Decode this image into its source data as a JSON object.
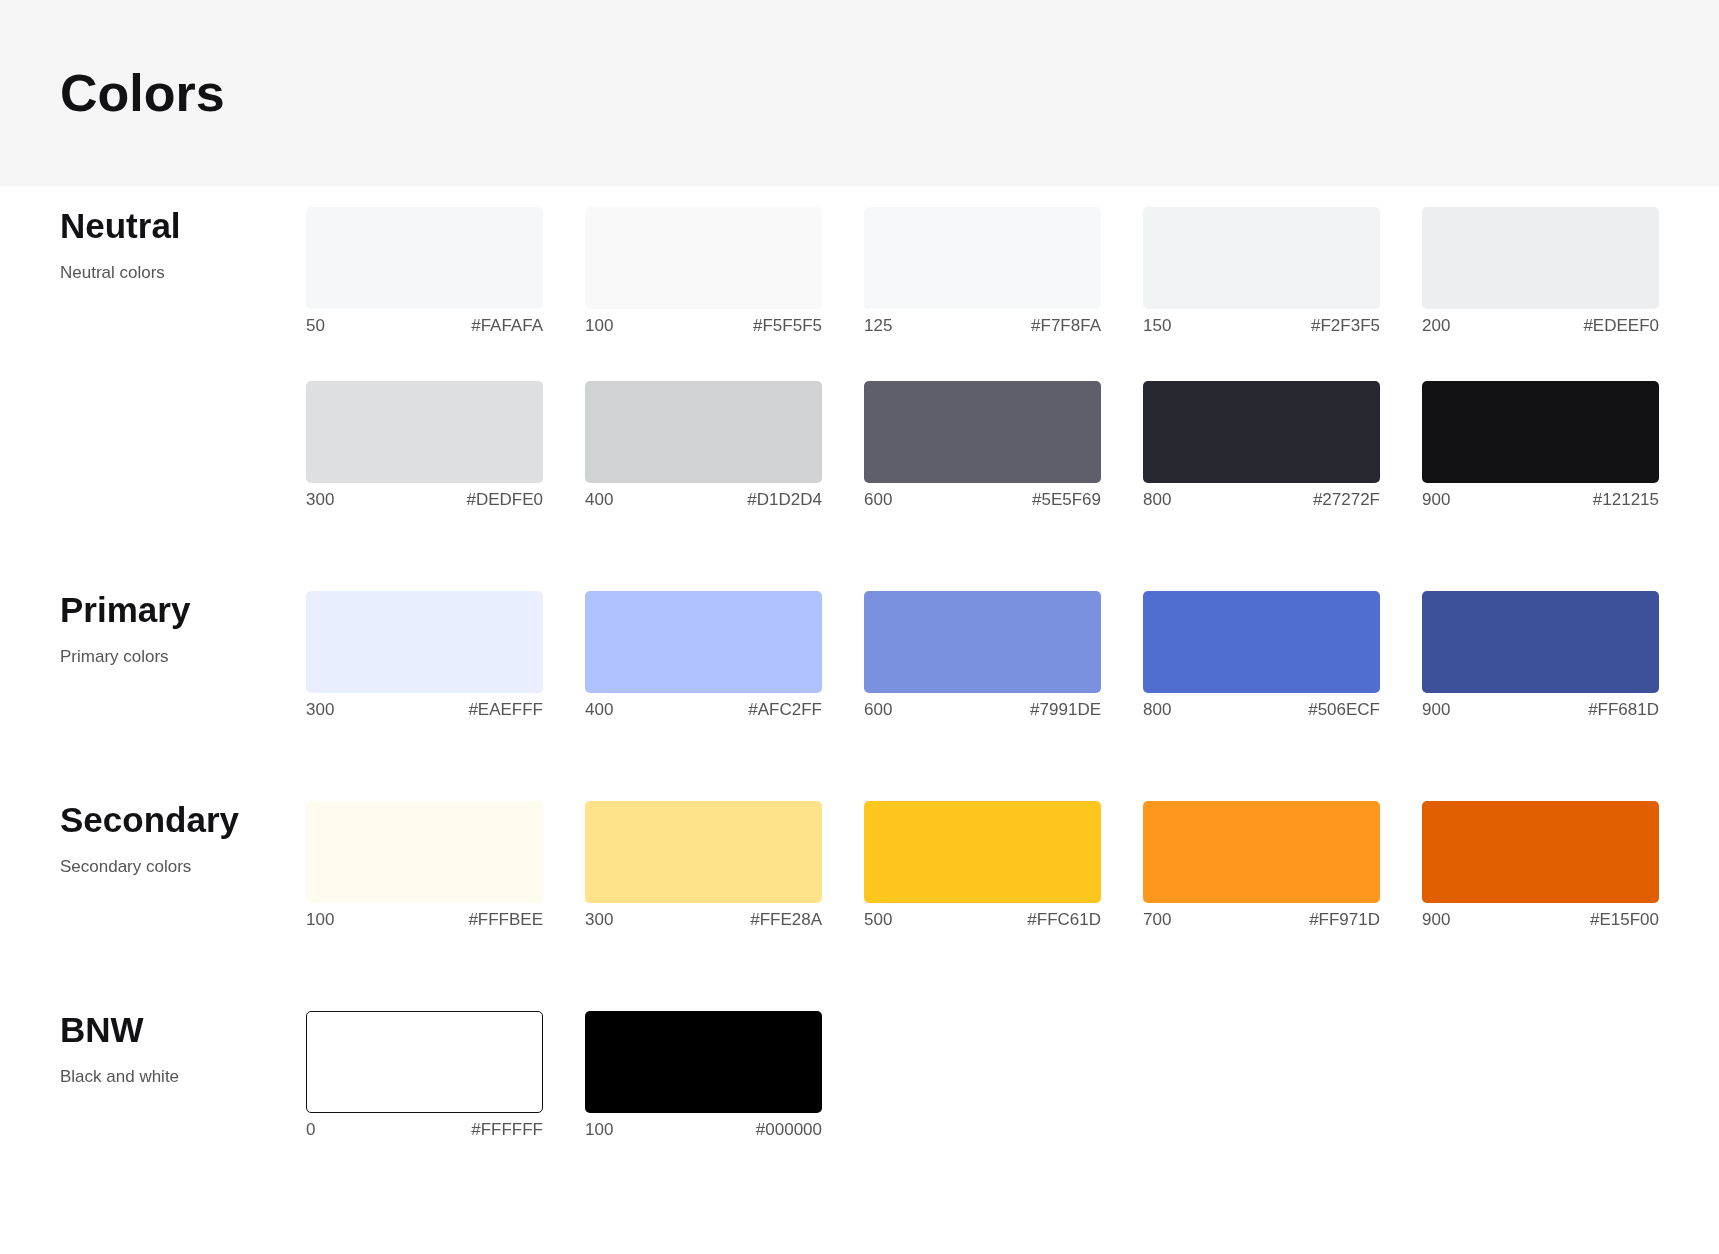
{
  "page": {
    "title": "Colors"
  },
  "sections": [
    {
      "title": "Neutral",
      "subtitle": "Neutral colors",
      "swatches": [
        {
          "shade": "50",
          "hex": "#FAFAFA",
          "color": "#f6f7f8",
          "outlined": false
        },
        {
          "shade": "100",
          "hex": "#F5F5F5",
          "color": "#f9f9fa",
          "outlined": false
        },
        {
          "shade": "125",
          "hex": "#F7F8FA",
          "color": "#f7f8fa",
          "outlined": false
        },
        {
          "shade": "150",
          "hex": "#F2F3F5",
          "color": "#f2f3f5",
          "outlined": false
        },
        {
          "shade": "200",
          "hex": "#EDEEF0",
          "color": "#edeef0",
          "outlined": false
        },
        {
          "shade": "300",
          "hex": "#DEDFE0",
          "color": "#dedfe0",
          "outlined": false
        },
        {
          "shade": "400",
          "hex": "#D1D2D4",
          "color": "#d1d2d4",
          "outlined": false
        },
        {
          "shade": "600",
          "hex": "#5E5F69",
          "color": "#5e5f69",
          "outlined": false
        },
        {
          "shade": "800",
          "hex": "#27272F",
          "color": "#27272f",
          "outlined": false
        },
        {
          "shade": "900",
          "hex": "#121215",
          "color": "#121215",
          "outlined": false
        }
      ]
    },
    {
      "title": "Primary",
      "subtitle": "Primary colors",
      "swatches": [
        {
          "shade": "300",
          "hex": "#EAEFFF",
          "color": "#eaefff",
          "outlined": false
        },
        {
          "shade": "400",
          "hex": "#AFC2FF",
          "color": "#afc2ff",
          "outlined": false
        },
        {
          "shade": "600",
          "hex": "#7991DE",
          "color": "#7991de",
          "outlined": false
        },
        {
          "shade": "800",
          "hex": "#506ECF",
          "color": "#506ecf",
          "outlined": false
        },
        {
          "shade": "900",
          "hex": "#FF681D",
          "color": "#3c5199",
          "outlined": false
        }
      ]
    },
    {
      "title": "Secondary",
      "subtitle": "Secondary colors",
      "swatches": [
        {
          "shade": "100",
          "hex": "#FFFBEE",
          "color": "#fffbee",
          "outlined": false
        },
        {
          "shade": "300",
          "hex": "#FFE28A",
          "color": "#ffe28a",
          "outlined": false
        },
        {
          "shade": "500",
          "hex": "#FFC61D",
          "color": "#ffc61d",
          "outlined": false
        },
        {
          "shade": "700",
          "hex": "#FF971D",
          "color": "#ff971d",
          "outlined": false
        },
        {
          "shade": "900",
          "hex": "#E15F00",
          "color": "#e15f00",
          "outlined": false
        }
      ]
    },
    {
      "title": "BNW",
      "subtitle": "Black and white",
      "swatches": [
        {
          "shade": "0",
          "hex": "#FFFFFF",
          "color": "#ffffff",
          "outlined": true
        },
        {
          "shade": "100",
          "hex": "#000000",
          "color": "#000000",
          "outlined": false
        }
      ]
    }
  ]
}
